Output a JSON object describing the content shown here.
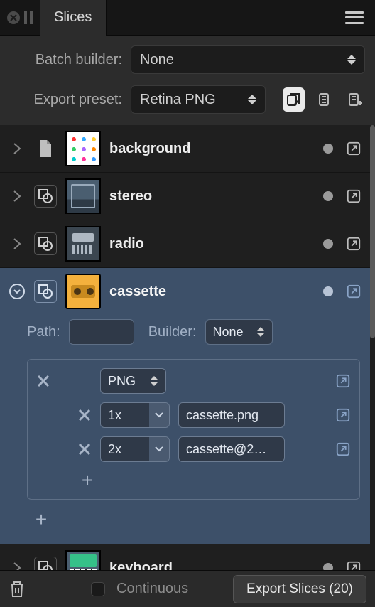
{
  "tabbar": {
    "title": "Slices"
  },
  "controls": {
    "batch_label": "Batch builder:",
    "batch_value": "None",
    "preset_label": "Export preset:",
    "preset_value": "Retina PNG"
  },
  "slices": [
    {
      "name": "background",
      "selected": false,
      "expanded": false,
      "thumb": "bg",
      "type": "page"
    },
    {
      "name": "stereo",
      "selected": false,
      "expanded": false,
      "thumb": "stereo",
      "type": "shape"
    },
    {
      "name": "radio",
      "selected": false,
      "expanded": false,
      "thumb": "radio",
      "type": "shape"
    },
    {
      "name": "cassette",
      "selected": true,
      "expanded": true,
      "thumb": "cassette",
      "type": "shape"
    },
    {
      "name": "keyboard",
      "selected": false,
      "expanded": false,
      "thumb": "keyboard",
      "type": "shape"
    }
  ],
  "expanded": {
    "path_label": "Path:",
    "path_value": "",
    "builder_label": "Builder:",
    "builder_value": "None",
    "format": "PNG",
    "variants": [
      {
        "scale": "1x",
        "filename": "cassette.png"
      },
      {
        "scale": "2x",
        "filename": "cassette@2…"
      }
    ]
  },
  "bottom": {
    "continuous_label": "Continuous",
    "export_label": "Export Slices (20)"
  }
}
